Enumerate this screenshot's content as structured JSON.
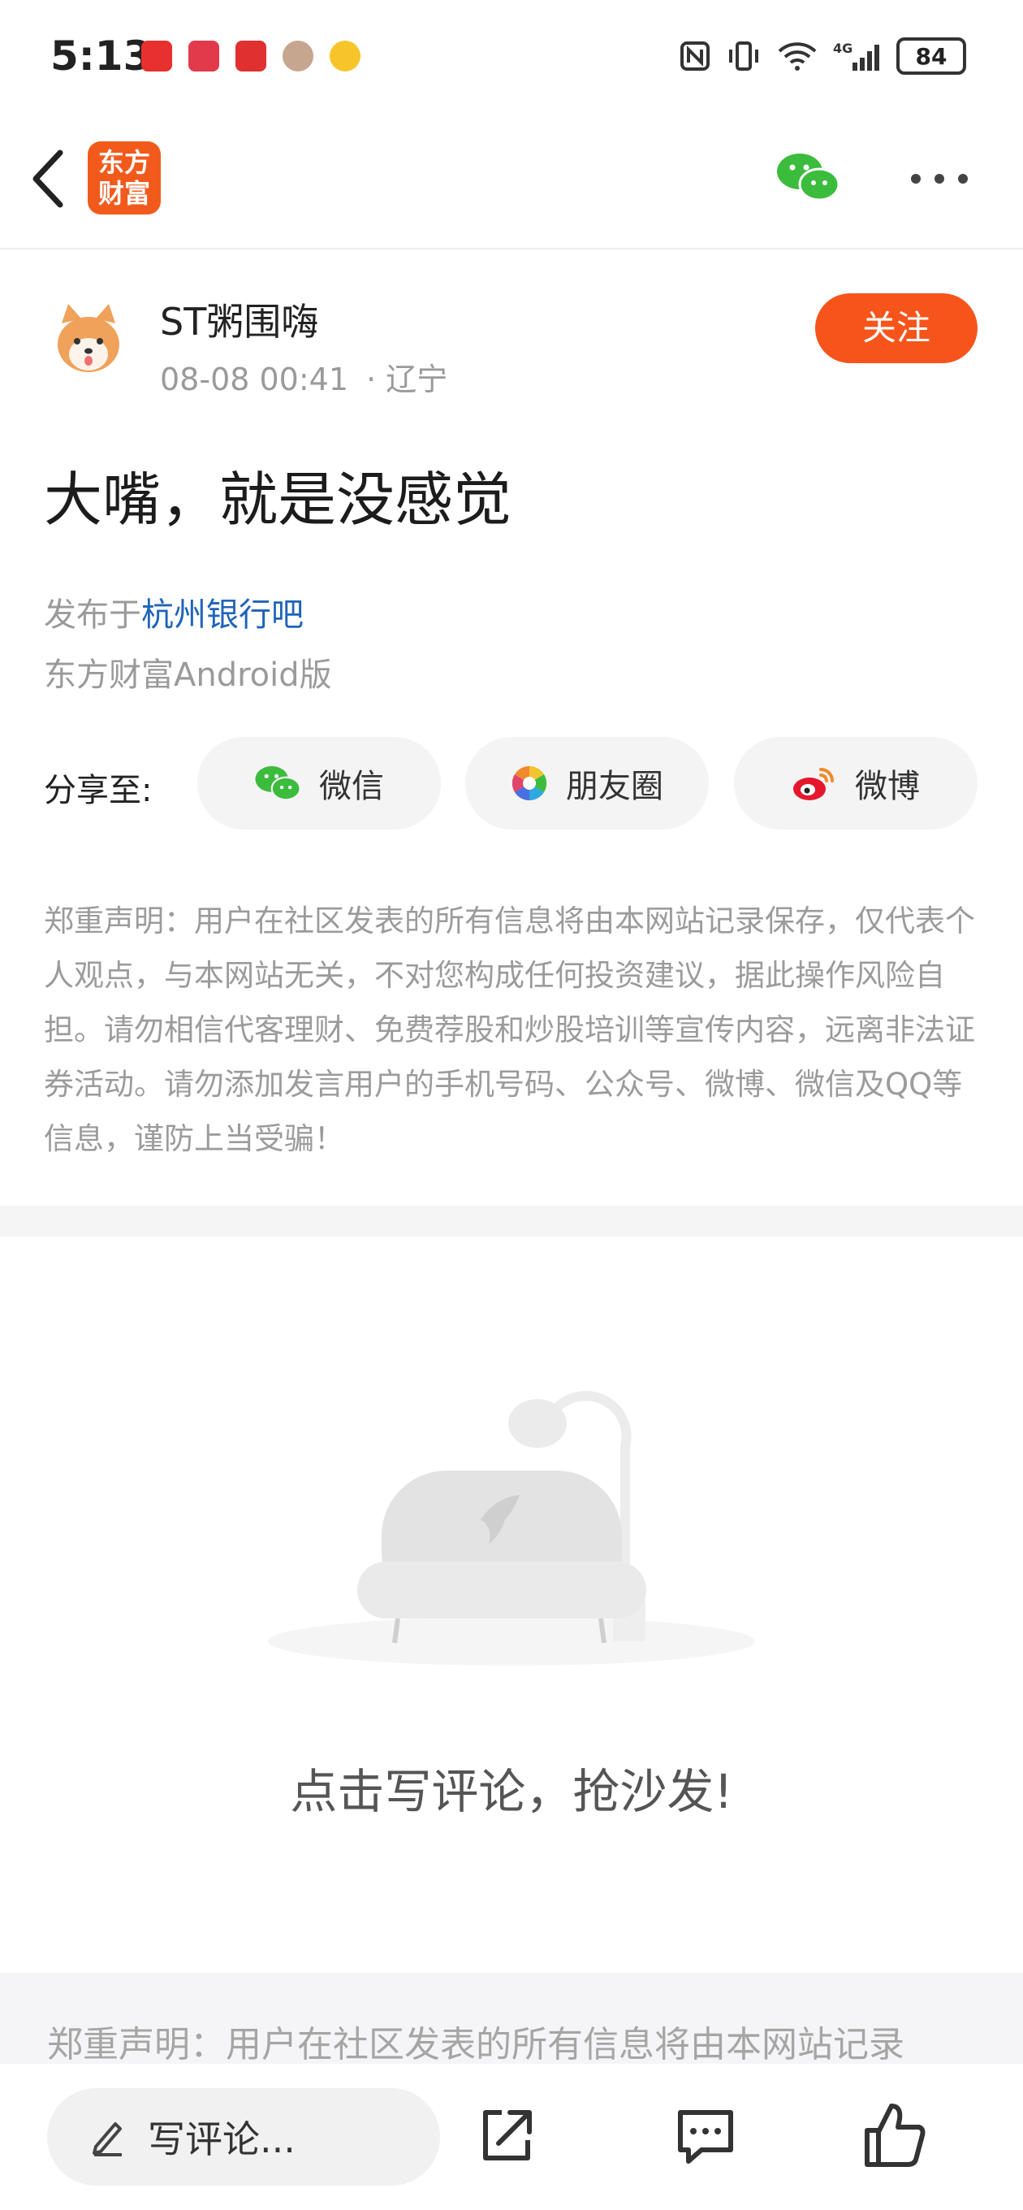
{
  "status_bar": {
    "time": "5:13",
    "battery": "84",
    "app_icons": [
      "red-app-icon",
      "red-app-icon-2",
      "red-app-icon-3",
      "avatar-app-icon",
      "weibo-app-icon"
    ],
    "right_icons": [
      "nfc-icon",
      "vibrate-icon",
      "wifi-icon",
      "signal-4g-icon",
      "battery-icon"
    ]
  },
  "header": {
    "logo_text": "东方\n财富",
    "back_icon": "chevron-left-icon",
    "wechat_icon": "wechat-icon",
    "more_icon": "more-dots-icon"
  },
  "author": {
    "name": "ST粥围嗨",
    "time": "08-08 00:41",
    "location": "· 辽宁",
    "follow_label": "关注"
  },
  "post": {
    "title": "大嘴，就是没感觉",
    "published_prefix": "发布于",
    "forum_name": "杭州银行吧",
    "client": "东方财富Android版"
  },
  "share": {
    "label": "分享至:",
    "items": [
      {
        "label": "微信",
        "icon": "wechat-icon"
      },
      {
        "label": "朋友圈",
        "icon": "moments-icon"
      },
      {
        "label": "微博",
        "icon": "weibo-icon"
      }
    ]
  },
  "disclaimer": "郑重声明：用户在社区发表的所有信息将由本网站记录保存，仅代表个人观点，与本网站无关，不对您构成任何投资建议，据此操作风险自担。请勿相信代客理财、免费荐股和炒股培训等宣传内容，远离非法证券活动。请勿添加发言用户的手机号码、公众号、微博、微信及QQ等信息，谨防上当受骗！",
  "empty_state": {
    "text": "点击写评论，抢沙发!"
  },
  "bottom_notice": "郑重声明：用户在社区发表的所有信息将由本网站记录",
  "bottom_bar": {
    "comment_placeholder": "写评论...",
    "icons": [
      "pencil-icon",
      "share-out-icon",
      "comment-icon",
      "thumbs-up-icon"
    ]
  },
  "colors": {
    "accent": "#f6541b",
    "link": "#1f64b8",
    "wechat_green": "#3cbc3c"
  }
}
